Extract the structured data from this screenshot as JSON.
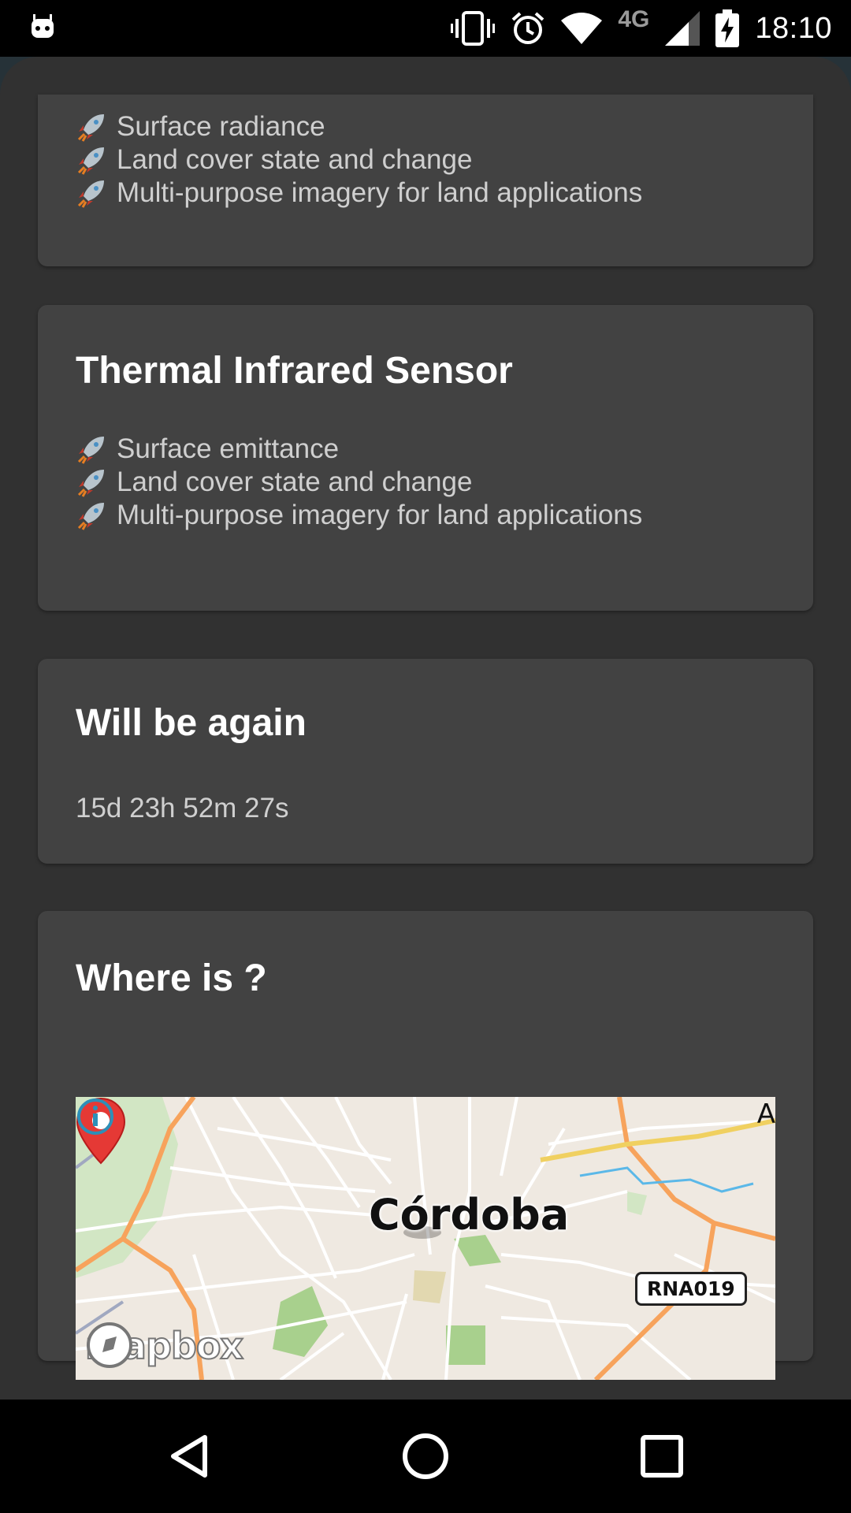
{
  "status_bar": {
    "time": "18:10",
    "network": "4G",
    "icons": [
      "android-debug-icon",
      "vibrate-icon",
      "alarm-icon",
      "wifi-icon",
      "signal-icon",
      "battery-charging-icon"
    ]
  },
  "cards": {
    "previous_instrument": {
      "features": [
        "Surface radiance",
        "Land cover state and change",
        "Multi-purpose imagery for land applications"
      ]
    },
    "tirs": {
      "title": "Thermal Infrared Sensor",
      "features": [
        "Surface emittance",
        "Land cover state and change",
        "Multi-purpose imagery for land applications"
      ]
    },
    "will_be_again": {
      "title": "Will be again",
      "countdown": "15d 23h 52m 27s"
    },
    "where_is": {
      "title": "Where is ?",
      "map": {
        "city_label": "Córdoba",
        "route_shield": "RNA019",
        "corner_label": "A",
        "attribution": "mapbox",
        "icons": [
          "map-pin-icon",
          "mapbox-logo-icon",
          "info-icon"
        ]
      }
    }
  },
  "nav_bar": {
    "icons": [
      "back-icon",
      "home-icon",
      "recents-icon"
    ]
  },
  "colors": {
    "background": "#313131",
    "card": "#424242",
    "title": "#ffffff",
    "body_text": "#cfcfcf",
    "pin": "#e53935",
    "road_major": "#f7a35c",
    "road_minor": "#ffffff"
  }
}
